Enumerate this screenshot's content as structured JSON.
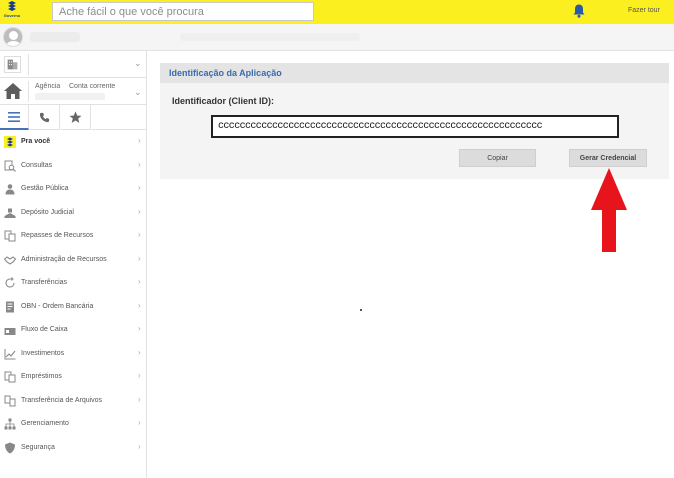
{
  "header": {
    "logo_text": "Governo",
    "search_placeholder": "Ache fácil o que você procura",
    "tour_label": "Fazer tour",
    "bell_icon": "bell-icon",
    "accent_color": "#fcef20"
  },
  "account": {
    "agencia_label": "Agência",
    "conta_label": "Conta corrente"
  },
  "tabs": [
    {
      "icon": "hamburger-menu-icon",
      "active": true
    },
    {
      "icon": "phone-icon",
      "active": false
    },
    {
      "icon": "star-icon",
      "active": false
    }
  ],
  "menu": [
    {
      "label": "Pra você",
      "icon": "bb-logo-icon"
    },
    {
      "label": "Consultas",
      "icon": "search-document-icon"
    },
    {
      "label": "Gestão Pública",
      "icon": "person-icon"
    },
    {
      "label": "Depósito Judicial",
      "icon": "gavel-icon"
    },
    {
      "label": "Repasses de Recursos",
      "icon": "transfer-document-icon"
    },
    {
      "label": "Administração de Recursos",
      "icon": "handshake-icon"
    },
    {
      "label": "Transferências",
      "icon": "refresh-icon"
    },
    {
      "label": "OBN - Ordem Bancária",
      "icon": "bank-order-icon"
    },
    {
      "label": "Fluxo de Caixa",
      "icon": "cash-flow-icon"
    },
    {
      "label": "Investimentos",
      "icon": "chart-icon"
    },
    {
      "label": "Empréstimos",
      "icon": "loan-document-icon"
    },
    {
      "label": "Transferência de Arquivos",
      "icon": "file-transfer-icon"
    },
    {
      "label": "Gerenciamento",
      "icon": "org-chart-icon"
    },
    {
      "label": "Segurança",
      "icon": "shield-icon"
    }
  ],
  "main": {
    "section_title": "Identificação da Aplicação",
    "id_label": "Identificador (Client ID):",
    "client_id": "cccccccccccccccccccccccccccccccccccccccccccccccccccccccccccc",
    "copy_button": "Copiar",
    "generate_button": "Gerar Credencial",
    "section_title_color": "#3a6ab0",
    "annotation_arrow_color": "#e8141b"
  }
}
